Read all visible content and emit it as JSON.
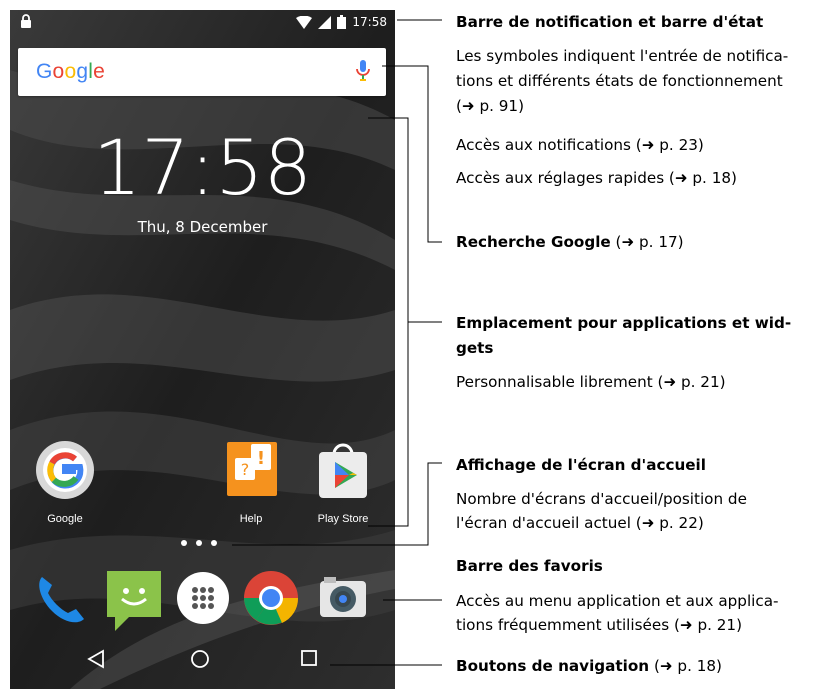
{
  "phone": {
    "status_bar": {
      "time": "17:58",
      "lock_icon": "lock-icon",
      "wifi_icon": "wifi-icon",
      "signal_icon": "signal-icon",
      "battery_icon": "battery-icon"
    },
    "search_widget": {
      "logo": "Google",
      "mic_icon": "mic-icon"
    },
    "clock": {
      "time": "17:58",
      "date": "Thu, 8 December"
    },
    "apps": [
      {
        "label": "Google",
        "icon": "google-icon"
      },
      {
        "label": "Help",
        "icon": "help-icon"
      },
      {
        "label": "Play Store",
        "icon": "play-store-icon"
      }
    ],
    "dock": [
      "phone-icon",
      "messaging-icon",
      "apps-menu-icon",
      "chrome-icon",
      "camera-icon"
    ],
    "nav": [
      "back-icon",
      "home-icon",
      "recents-icon"
    ]
  },
  "annotations": {
    "status_title": "Barre de notification et barre d'état",
    "status_desc_1": "Les symboles indiquent l'entrée de notifica-",
    "status_desc_2": "tions et différents états de fonctionnement",
    "status_desc_3": "(➜ p. 91)",
    "notif_access": "Accès aux notifications (➜ p. 23)",
    "quick_settings": "Accès aux réglages rapides (➜ p. 18)",
    "search_title": "Recherche Google",
    "search_ref": " (➜ p. 17)",
    "apps_title_1": "Emplacement pour applications et wid-",
    "apps_title_2": "gets",
    "apps_desc": "Personnalisable librement (➜ p. 21)",
    "home_title": "Affichage de l'écran d'accueil",
    "home_desc_1": "Nombre d'écrans d'accueil/position de",
    "home_desc_2": "l'écran d'accueil actuel (➜ p. 22)",
    "fav_title": "Barre des favoris",
    "fav_desc_1": "Accès au menu application et aux applica-",
    "fav_desc_2": "tions fréquemment utilisées (➜ p. 21)",
    "nav_title": "Boutons de navigation",
    "nav_ref": " (➜ p. 18)"
  },
  "colors": {
    "accent_blue": "#4285F4",
    "red": "#EA4335",
    "yellow": "#FBBC05",
    "green": "#34A853",
    "help_orange": "#F5921E"
  }
}
